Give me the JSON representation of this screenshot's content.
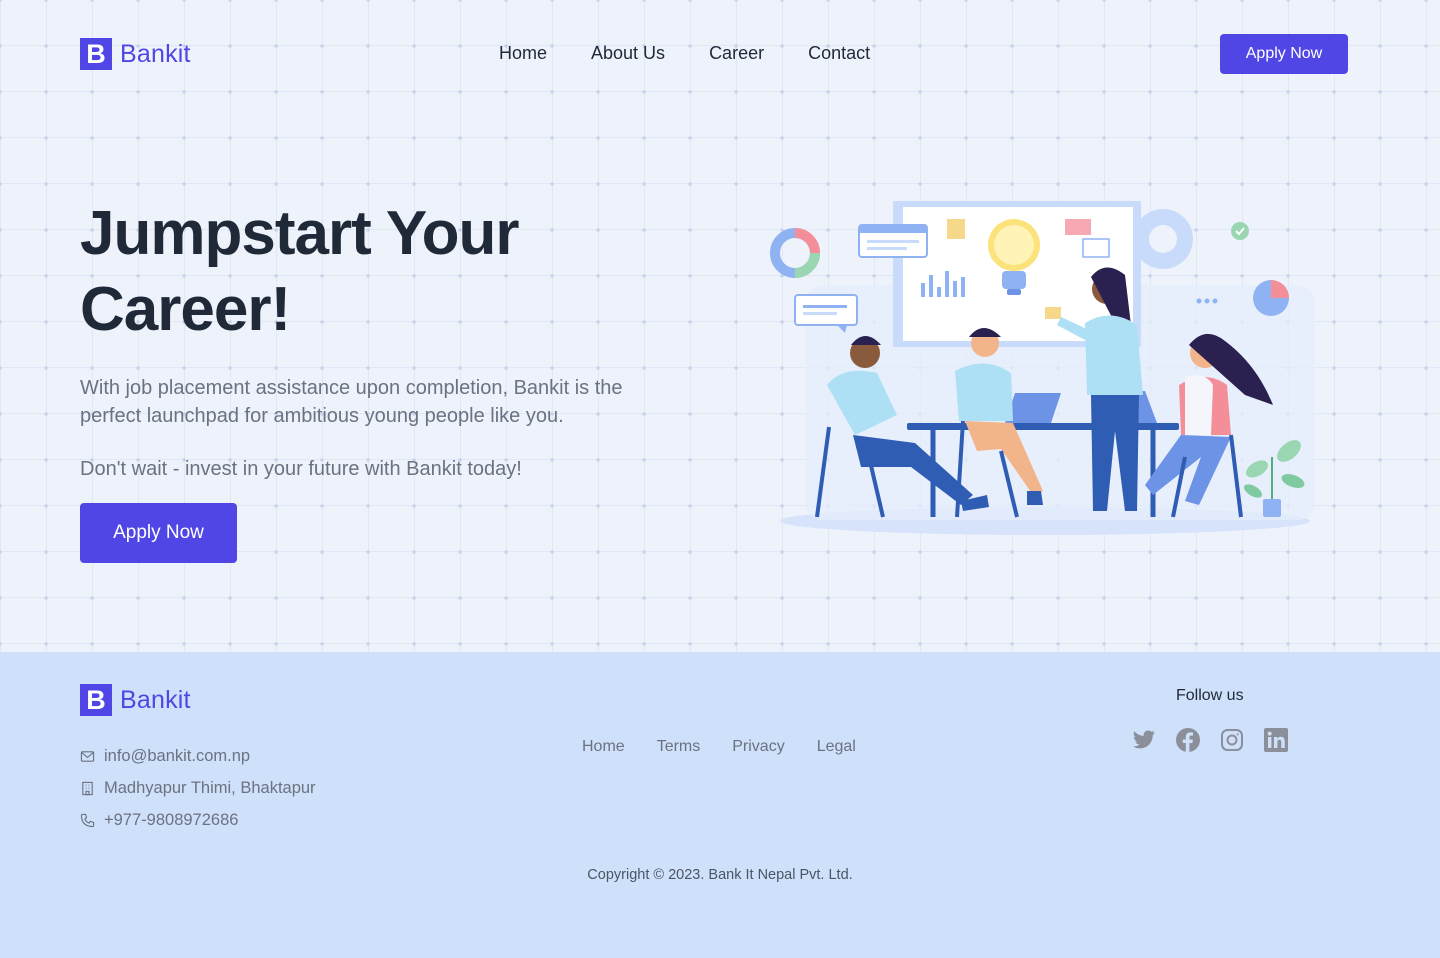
{
  "brand": {
    "mark": "B",
    "name": "Bankit",
    "accent": "#4f46e5"
  },
  "nav": {
    "links": [
      "Home",
      "About Us",
      "Career",
      "Contact"
    ],
    "apply_label": "Apply Now"
  },
  "hero": {
    "title_line1": "Jumpstart Your",
    "title_line2": "Career!",
    "subtitle": "With job placement assistance upon completion, Bankit is the perfect launchpad for ambitious young people like you.",
    "cta_text": "Don't wait - invest in your future with Bankit today!",
    "apply_label": "Apply Now",
    "illustration_icon": "team-meeting-illustration"
  },
  "footer": {
    "contact": {
      "email": "info@bankit.com.np",
      "address": "Madhyapur Thimi, Bhaktapur",
      "phone": "+977-9808972686"
    },
    "links": [
      "Home",
      "Terms",
      "Privacy",
      "Legal"
    ],
    "follow_label": "Follow us",
    "socials": [
      "twitter-icon",
      "facebook-icon",
      "instagram-icon",
      "linkedin-icon"
    ],
    "copyright": "Copyright © 2023. Bank It Nepal Pvt. Ltd."
  }
}
